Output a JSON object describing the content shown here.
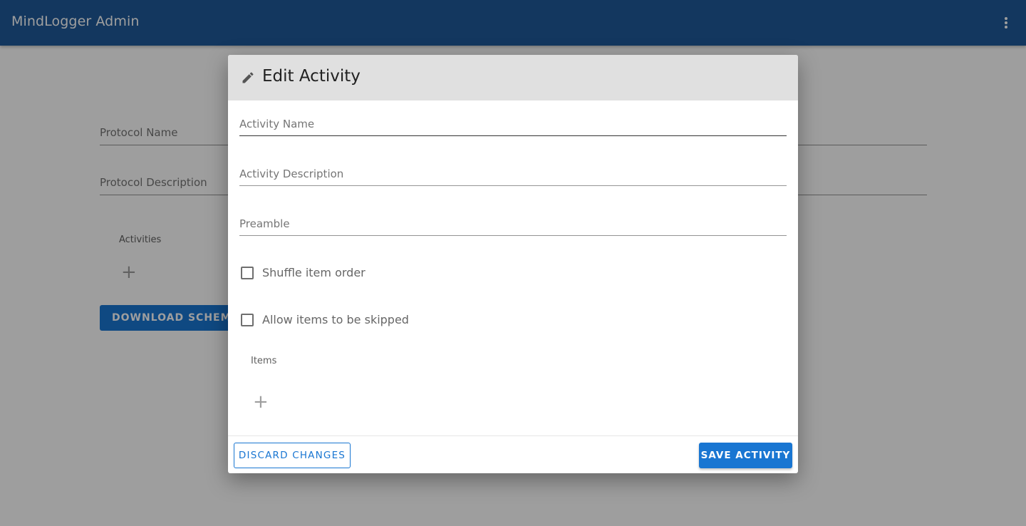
{
  "appbar": {
    "title": "MindLogger Admin",
    "menu_icon": "more-vert-icon"
  },
  "page": {
    "protocol_name_label": "Protocol Name",
    "protocol_description_label": "Protocol Description",
    "activities_label": "Activities",
    "add_activity_icon": "+",
    "download_button": "DOWNLOAD SCHEMA"
  },
  "dialog": {
    "title": "Edit Activity",
    "title_icon": "pencil-icon",
    "fields": {
      "activity_name": {
        "label": "Activity Name",
        "value": ""
      },
      "activity_description": {
        "label": "Activity Description",
        "value": ""
      },
      "preamble": {
        "label": "Preamble",
        "value": ""
      }
    },
    "checkboxes": {
      "shuffle": {
        "label": "Shuffle item order",
        "checked": false
      },
      "allow_skip": {
        "label": "Allow items to be skipped",
        "checked": false
      }
    },
    "items_label": "Items",
    "add_item_icon": "+",
    "discard_button": "DISCARD CHANGES",
    "save_button": "SAVE ACTIVITY"
  },
  "colors": {
    "appbar": "#1f5a99",
    "primary": "#1976d2",
    "dialog_header": "#e0e0e0"
  }
}
